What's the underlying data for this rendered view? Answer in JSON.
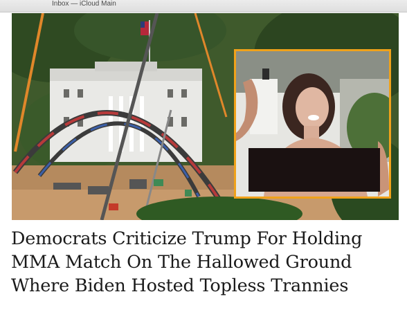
{
  "window": {
    "title": "Inbox — iCloud Main"
  },
  "article": {
    "headline_lines": [
      "Democrats Criticize Trump For Holding",
      "MMA Match On The Hallowed Ground",
      "Where Biden Hosted Topless Trannies"
    ]
  },
  "colors": {
    "inset_border": "#f0a21a",
    "censor_bar": "#1a1111",
    "headline_text": "#1a1a1a"
  }
}
